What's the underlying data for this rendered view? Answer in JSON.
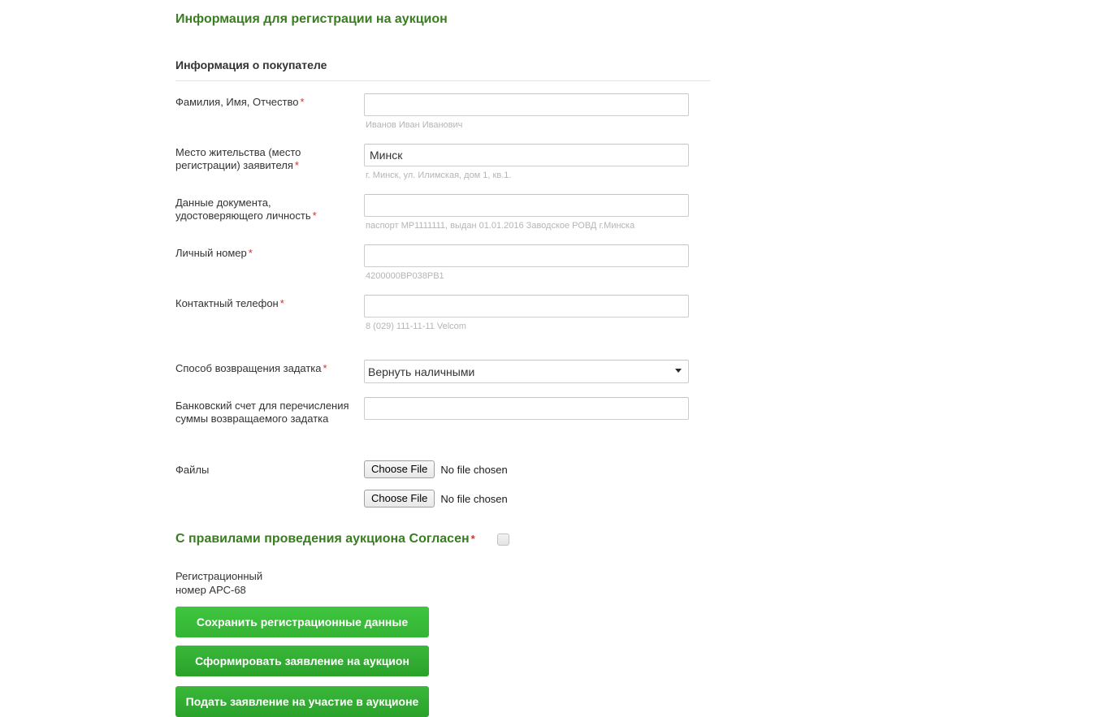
{
  "page": {
    "title": "Информация для регистрации на аукцион",
    "section_title": "Информация о покупателе"
  },
  "fields": {
    "full_name": {
      "label": "Фамилия, Имя, Отчество",
      "required_marker": "*",
      "value": "",
      "hint": "Иванов Иван Иванович"
    },
    "residence": {
      "label": "Место жительства (место регистрации) заявителя",
      "required_marker": "*",
      "value": "Минск",
      "hint": "г. Минск, ул. Илимская, дом 1, кв.1."
    },
    "id_document": {
      "label": "Данные документа, удостоверяющего личность",
      "required_marker": "*",
      "value": "",
      "hint": "паспорт МР1111111, выдан 01.01.2016 Заводское РОВД г.Минска"
    },
    "personal_number": {
      "label": "Личный номер",
      "required_marker": "*",
      "value": "",
      "hint": "4200000ВР038РВ1"
    },
    "phone": {
      "label": "Контактный телефон",
      "required_marker": "*",
      "value": "",
      "hint": "8 (029) 111-11-11 Velcom"
    },
    "deposit_return_method": {
      "label": "Способ возвращения задатка",
      "required_marker": "*",
      "selected": "Вернуть наличными",
      "options": [
        "Вернуть наличными"
      ]
    },
    "bank_account": {
      "label": "Банковский счет для перечисления суммы возвращаемого задатка",
      "value": ""
    },
    "files": {
      "label": "Файлы",
      "button_label": "Choose File",
      "status": "No file chosen"
    }
  },
  "agreement": {
    "text": "С правилами проведения аукциона Согласен",
    "required_marker": "*",
    "checked": false
  },
  "registration": {
    "line1": "Регистрационный",
    "line2": "номер АРС-68"
  },
  "buttons": {
    "save": "Сохранить регистрационные данные",
    "generate": "Сформировать заявление на аукцион",
    "submit": "Подать заявление на участие в аукционе"
  },
  "colors": {
    "heading_green": "#3a7d21",
    "button_green": "#34b434",
    "required_red": "#cc3333",
    "hint_gray": "#b5b5b5"
  }
}
